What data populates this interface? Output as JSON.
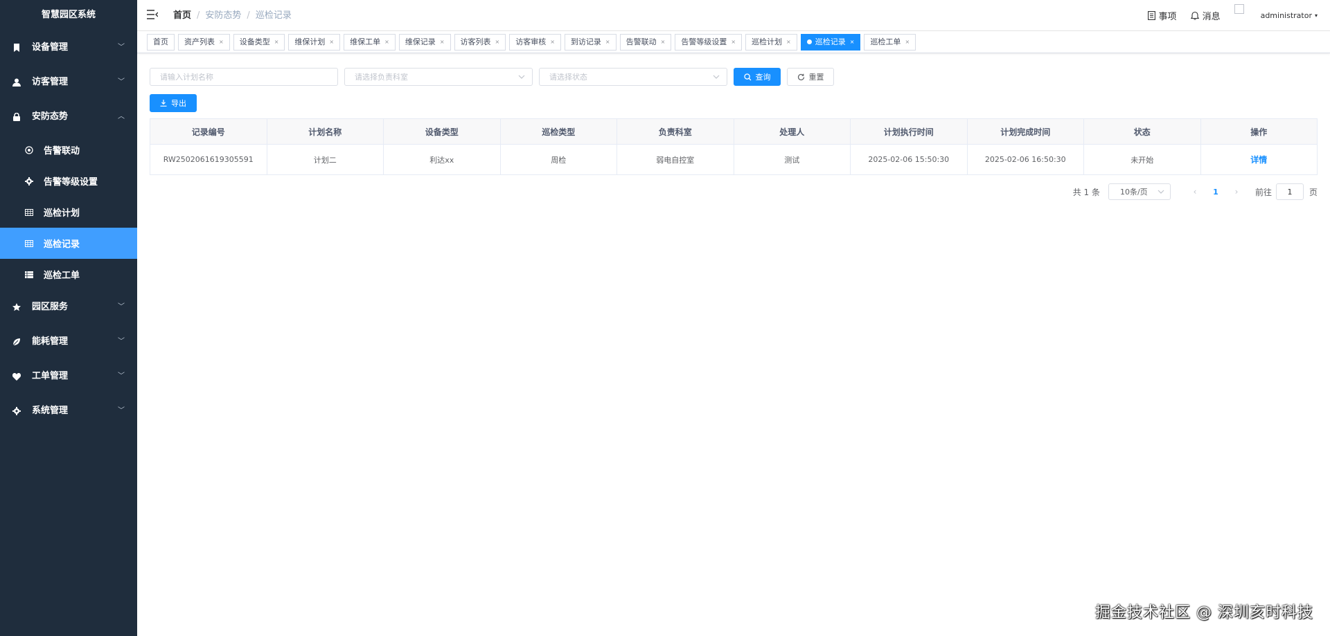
{
  "sidebar": {
    "logo": "智慧园区系统",
    "menu": [
      {
        "label": "设备管理"
      },
      {
        "label": "访客管理"
      },
      {
        "label": "安防态势"
      }
    ],
    "sub_items": [
      {
        "label": "告警联动"
      },
      {
        "label": "告警等级设置"
      },
      {
        "label": "巡检计划"
      },
      {
        "label": "巡检记录"
      },
      {
        "label": "巡检工单"
      }
    ],
    "menu_after": [
      {
        "label": "园区服务"
      },
      {
        "label": "能耗管理"
      },
      {
        "label": "工单管理"
      },
      {
        "label": "系统管理"
      }
    ],
    "active_color": "#409eff",
    "bg_color": "#1f2d3d"
  },
  "navbar": {
    "breadcrumb": [
      "首页",
      "安防态势",
      "巡检记录"
    ],
    "separator": "/",
    "todo_label": "事项",
    "message_label": "消息",
    "username": "administrator",
    "caret": "▾"
  },
  "tags": [
    {
      "label": "首页"
    },
    {
      "label": "资产列表"
    },
    {
      "label": "设备类型"
    },
    {
      "label": "维保计划"
    },
    {
      "label": "维保工单"
    },
    {
      "label": "维保记录"
    },
    {
      "label": "访客列表"
    },
    {
      "label": "访客审核"
    },
    {
      "label": "到访记录"
    },
    {
      "label": "告警联动"
    },
    {
      "label": "告警等级设置"
    },
    {
      "label": "巡检计划"
    },
    {
      "label": "巡检记录"
    },
    {
      "label": "巡检工单"
    }
  ],
  "tag_close": "×",
  "filters": {
    "plan_name_placeholder": "请输入计划名称",
    "department_placeholder": "请选择负责科室",
    "status_placeholder": "请选择状态",
    "search_label": "查询",
    "reset_label": "重置"
  },
  "export_label": "导出",
  "table": {
    "headers": [
      "记录编号",
      "计划名称",
      "设备类型",
      "巡检类型",
      "负责科室",
      "处理人",
      "计划执行时间",
      "计划完成时间",
      "状态",
      "操作"
    ],
    "rows": [
      [
        "RW2502061619305591",
        "计划二",
        "利达xx",
        "周检",
        "弱电自控室",
        "测试",
        "2025-02-06 15:50:30",
        "2025-02-06 16:50:30",
        "未开始",
        "详情"
      ]
    ]
  },
  "pagination": {
    "total": "共 1 条",
    "page_size": "10条/页",
    "prev": "‹",
    "current": "1",
    "next": "›",
    "goto_label": "前往",
    "goto_value": "1",
    "page_suffix": "页"
  },
  "watermark": "掘金技术社区 @ 深圳亥时科技",
  "accent_color": "#1890ff"
}
